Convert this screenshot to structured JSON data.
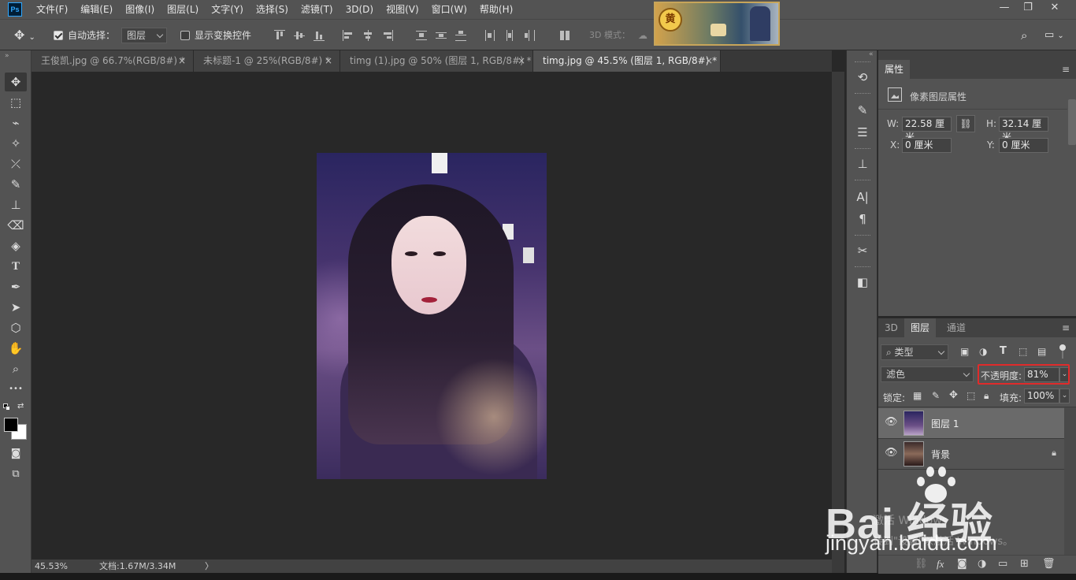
{
  "app": {
    "logo": "Ps",
    "menu": [
      "文件(F)",
      "编辑(E)",
      "图像(I)",
      "图层(L)",
      "文字(Y)",
      "选择(S)",
      "滤镜(T)",
      "3D(D)",
      "视图(V)",
      "窗口(W)",
      "帮助(H)"
    ],
    "window_controls": {
      "minimize": "—",
      "restore": "❐",
      "close": "✕"
    }
  },
  "options_bar": {
    "auto_select_label": "自动选择：",
    "auto_select_checked": true,
    "auto_select_target": "图层",
    "show_transform_label": "显示变换控件",
    "show_transform_checked": false,
    "mode_3d_label": "3D 模式："
  },
  "tabs": [
    {
      "label": "王俊凯.jpg @ 66.7%(RGB/8#) *",
      "active": false
    },
    {
      "label": "未标题-1 @ 25%(RGB/8#) *",
      "active": false
    },
    {
      "label": "timg (1).jpg @ 50% (图层 1, RGB/8#) *",
      "active": false
    },
    {
      "label": "timg.jpg @ 45.5% (图层 1, RGB/8#) *",
      "active": true
    }
  ],
  "tab_close_glyph": "×",
  "tools": [
    {
      "name": "move-tool-icon",
      "glyph": "✥",
      "selected": true
    },
    {
      "name": "marquee-tool-icon",
      "glyph": "⬚"
    },
    {
      "name": "lasso-tool-icon",
      "glyph": "⌁"
    },
    {
      "name": "magic-wand-tool-icon",
      "glyph": "✧"
    },
    {
      "name": "eyedropper-tool-icon",
      "glyph": "⤫"
    },
    {
      "name": "brush-tool-icon",
      "glyph": "✎"
    },
    {
      "name": "stamp-tool-icon",
      "glyph": "⊥"
    },
    {
      "name": "eraser-tool-icon",
      "glyph": "⌫"
    },
    {
      "name": "paint-bucket-tool-icon",
      "glyph": "◈"
    },
    {
      "name": "type-tool-icon",
      "glyph": "T"
    },
    {
      "name": "pen-tool-icon",
      "glyph": "✒"
    },
    {
      "name": "path-select-tool-icon",
      "glyph": "➤"
    },
    {
      "name": "shape-tool-icon",
      "glyph": "⬡"
    },
    {
      "name": "hand-tool-icon",
      "glyph": "✋"
    },
    {
      "name": "zoom-tool-icon",
      "glyph": "⌕"
    },
    {
      "name": "more-tools-icon",
      "glyph": "•••"
    }
  ],
  "status": {
    "zoom": "45.53%",
    "doc": "文档:1.67M/3.34M",
    "arrow": "〉"
  },
  "properties": {
    "title": "属性",
    "section": "像素图层属性",
    "w_label": "W:",
    "w_value": "22.58 厘米",
    "h_label": "H:",
    "h_value": "32.14 厘米",
    "x_label": "X:",
    "x_value": "0 厘米",
    "y_label": "Y:",
    "y_value": "0 厘米"
  },
  "layers_panel": {
    "tabs": [
      "3D",
      "图层",
      "通道"
    ],
    "active_tab": "图层",
    "filter_kind": "类型",
    "blend_mode": "滤色",
    "opacity_label": "不透明度:",
    "opacity_value": "81%",
    "lock_label": "锁定:",
    "fill_label": "填充:",
    "fill_value": "100%",
    "layers": [
      {
        "name": "图层 1",
        "selected": true,
        "visible": true,
        "locked": false
      },
      {
        "name": "背景",
        "selected": false,
        "visible": true,
        "locked": true
      }
    ],
    "footer_icons": [
      "link-layers-icon",
      "fx-icon",
      "mask-icon",
      "adjustment-icon",
      "group-icon",
      "new-layer-icon",
      "delete-icon"
    ]
  },
  "watermark": {
    "brand": "Bai  经验",
    "url": "jingyan.baidu.com",
    "activate_line1": "激活 Windows",
    "activate_line2": "转到\"设置\"以激活 Windows。"
  },
  "banner_char": "黄"
}
